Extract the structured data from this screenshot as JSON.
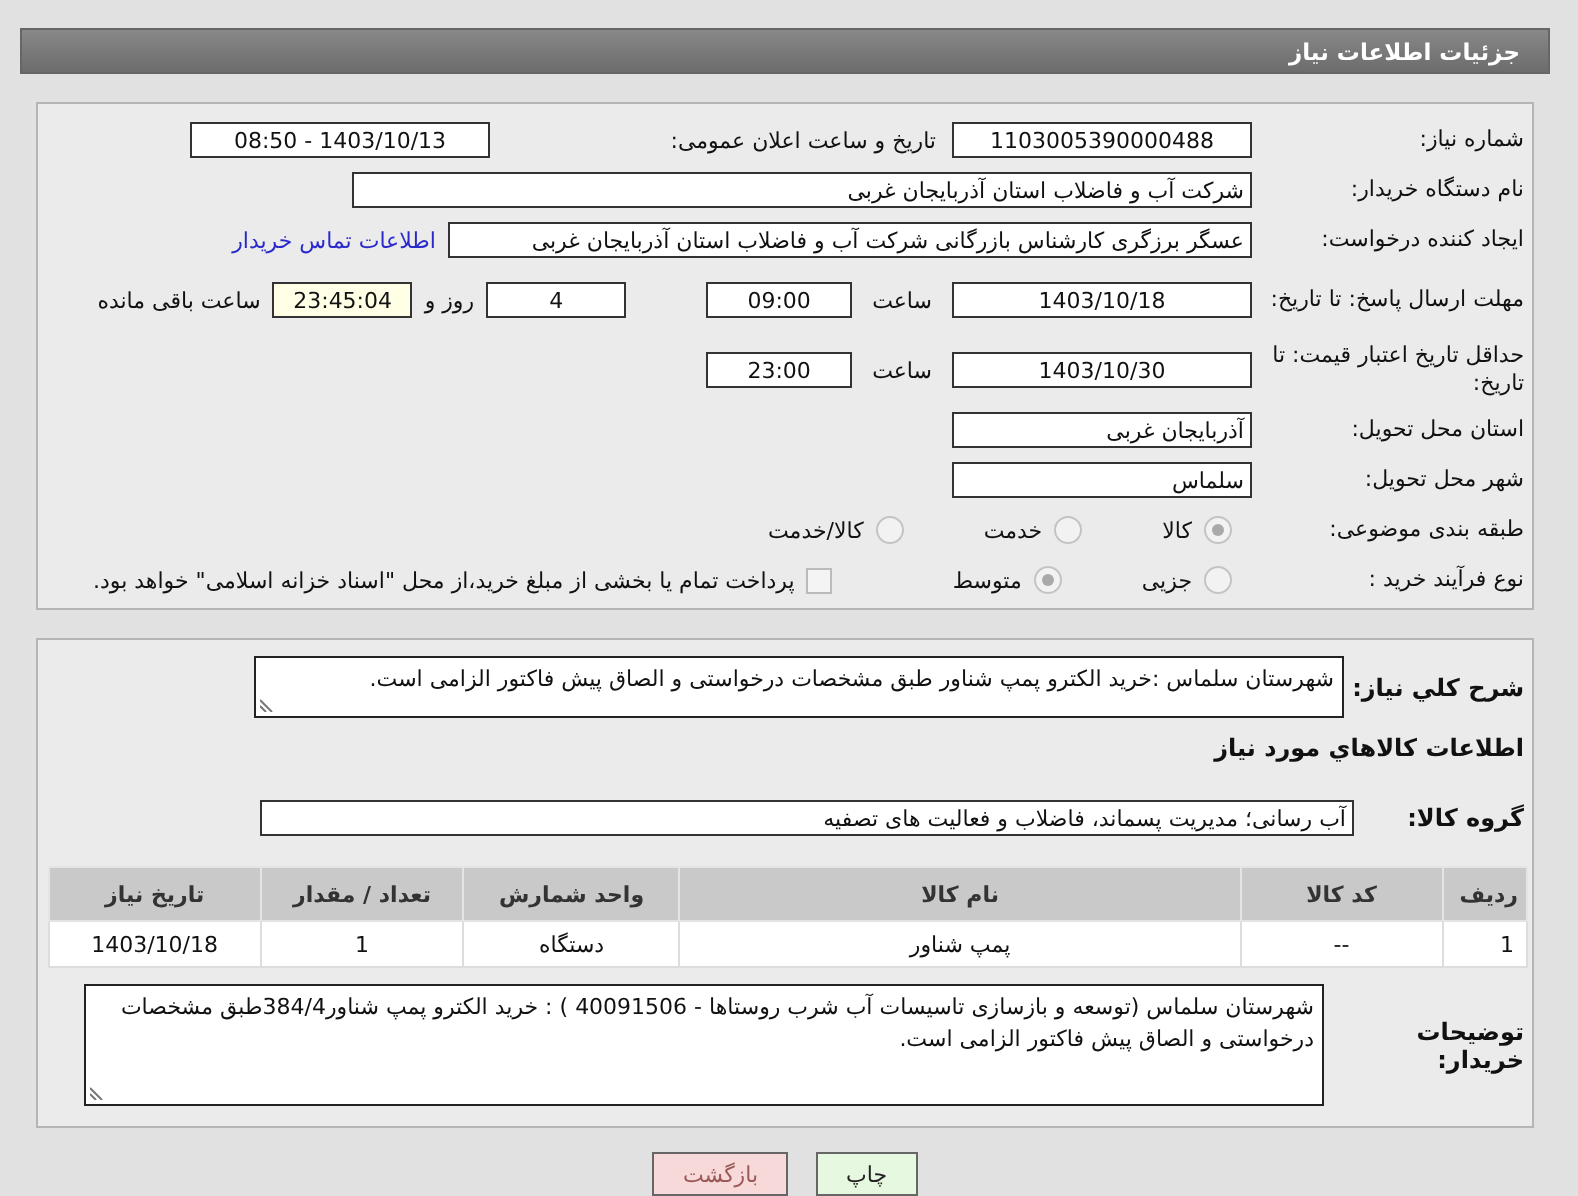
{
  "header": {
    "title": "جزئیات اطلاعات نیاز"
  },
  "need_number": {
    "label": "شماره نیاز:",
    "value": "1103005390000488"
  },
  "announce": {
    "label": "تاریخ و ساعت اعلان عمومی:",
    "value": "1403/10/13 - 08:50"
  },
  "buyer_org": {
    "label": "نام دستگاه خریدار:",
    "value": "شرکت آب و فاضلاب استان آذربایجان غربی"
  },
  "requester": {
    "label": "ایجاد کننده درخواست:",
    "value": "عسگر  برزگری کارشناس بازرگانی شرکت آب و فاضلاب استان آذربایجان غربی",
    "link": "اطلاعات تماس خریدار"
  },
  "response_deadline": {
    "label": "مهلت ارسال پاسخ: تا تاریخ:",
    "date": "1403/10/18",
    "time_label": "ساعت",
    "time": "09:00",
    "days": "4",
    "days_label": "روز و",
    "remaining": "23:45:04",
    "remaining_label": "ساعت باقی مانده"
  },
  "price_validity": {
    "label": "حداقل تاریخ اعتبار قیمت: تا تاریخ:",
    "date": "1403/10/30",
    "time_label": "ساعت",
    "time": "23:00"
  },
  "province": {
    "label": "استان محل تحویل:",
    "value": "آذربایجان غربی"
  },
  "city": {
    "label": "شهر محل تحویل:",
    "value": "سلماس"
  },
  "category": {
    "label": "طبقه بندی موضوعی:",
    "options": [
      {
        "label": "کالا",
        "selected": true
      },
      {
        "label": "خدمت",
        "selected": false
      },
      {
        "label": "کالا/خدمت",
        "selected": false
      }
    ]
  },
  "process": {
    "label": "نوع فرآیند خرید :",
    "options": [
      {
        "label": "جزیی",
        "selected": false
      },
      {
        "label": "متوسط",
        "selected": true
      }
    ],
    "payment": {
      "label": "پرداخت تمام یا بخشی از مبلغ خرید،از محل \"اسناد خزانه اسلامی\" خواهد بود.",
      "checked": false
    }
  },
  "description": {
    "label": "شرح کلي نياز:",
    "value": "شهرستان سلماس :خرید الکترو پمپ شناور طبق مشخصات درخواستی و الصاق پیش فاکتور الزامی است."
  },
  "goods_title": "اطلاعات کالاهاي مورد نياز",
  "goods_group": {
    "label": "گروه کالا:",
    "value": "آب رسانی؛ مدیریت پسماند، فاضلاب و فعالیت های تصفیه"
  },
  "table": {
    "columns": [
      "ردیف",
      "کد کالا",
      "نام کالا",
      "واحد شمارش",
      "تعداد / مقدار",
      "تاریخ نیاز"
    ],
    "rows": [
      [
        "1",
        "--",
        "پمپ شناور",
        "دستگاه",
        "1",
        "1403/10/18"
      ]
    ]
  },
  "buyer_notes": {
    "label": "توضیحات خریدار:",
    "value": "شهرستان سلماس (توسعه و بازسازی تاسیسات آب شرب روستاها  - 40091506 ) : خرید الکترو پمپ شناور384/4طبق مشخصات درخواستی و الصاق پیش فاکتور الزامی است."
  },
  "buttons": [
    {
      "label": "چاپ",
      "kind": "print"
    },
    {
      "label": "بازگشت",
      "kind": "back"
    }
  ]
}
